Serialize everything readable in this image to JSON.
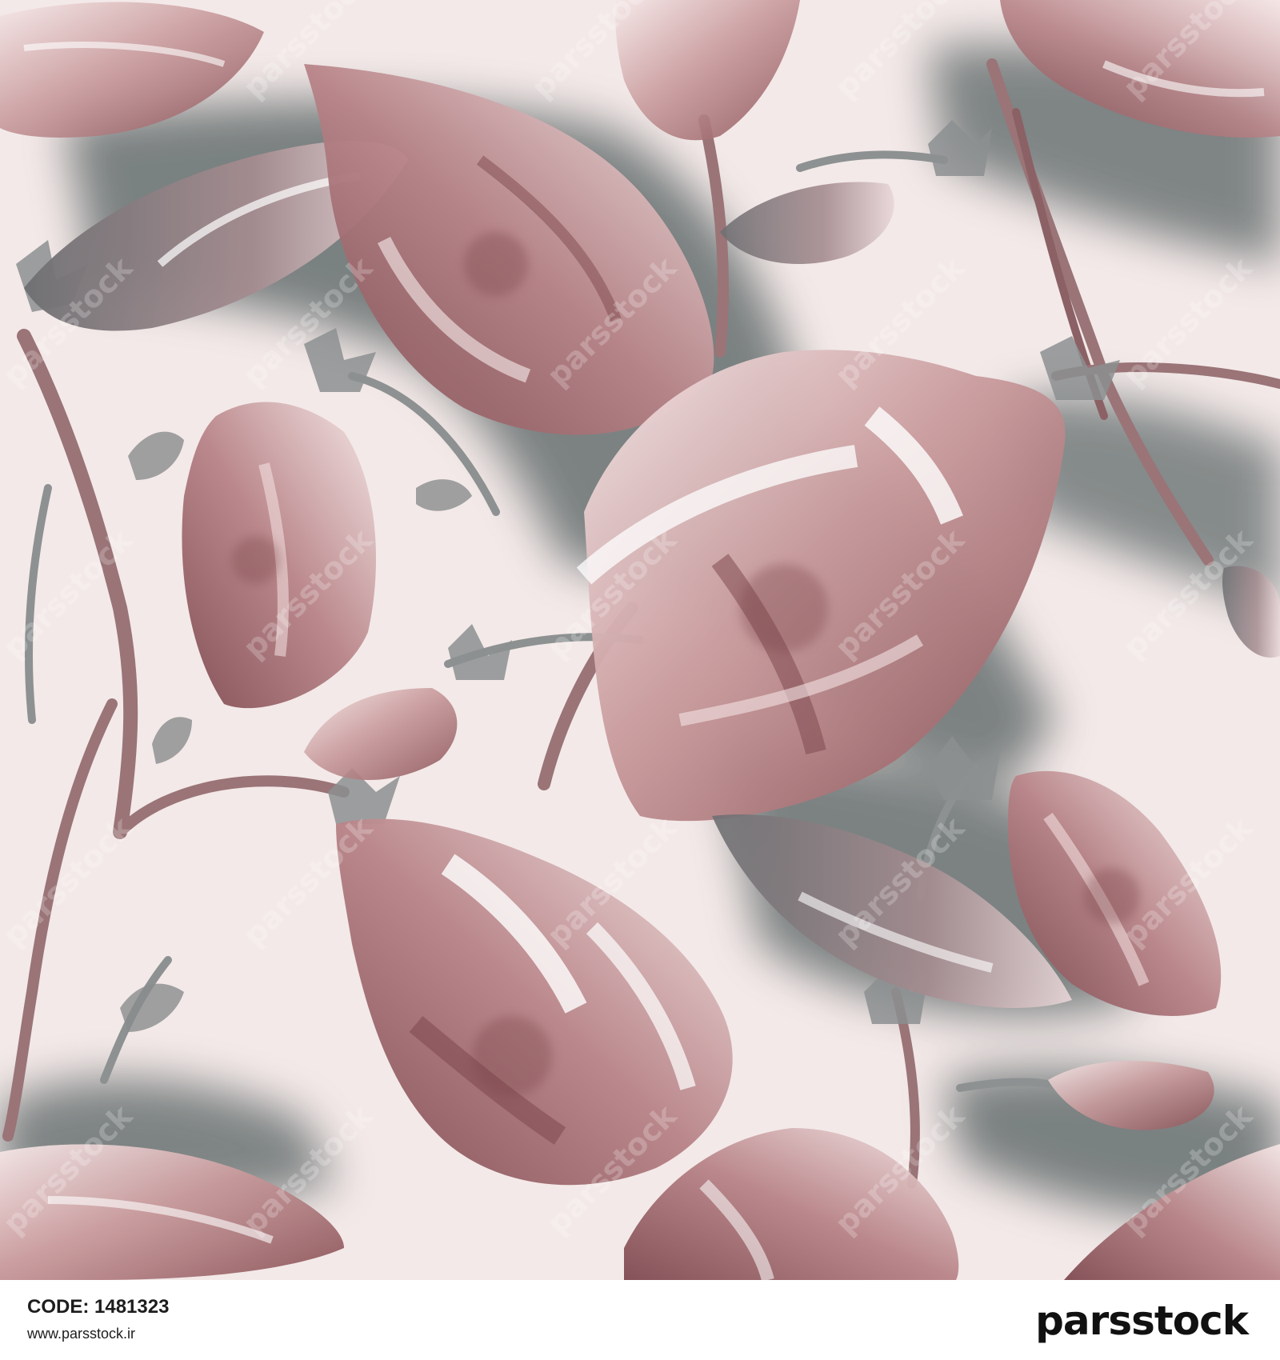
{
  "artwork": {
    "colors": {
      "paper": "#f3e9e8",
      "shadow": "#6f7675",
      "petal_light": "#efdcdc",
      "petal_mid": "#c49a9a",
      "petal_dark": "#8c5458",
      "stem": "#9c7578",
      "sepal": "#8a8e8e"
    }
  },
  "watermark": {
    "text": "parsstock"
  },
  "footer": {
    "code_label": "CODE:",
    "code_value": "1481323",
    "url": "www.parsstock.ir",
    "brand": "parsstock"
  }
}
